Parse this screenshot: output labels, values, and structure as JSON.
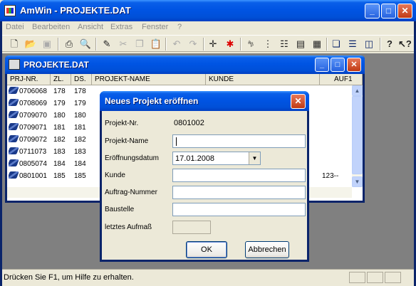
{
  "app": {
    "title": "AmWin - PROJEKTE.DAT",
    "minimize": "_",
    "maximize": "□",
    "close": "✕"
  },
  "menu": [
    "Datei",
    "Bearbeiten",
    "Ansicht",
    "Extras",
    "Fenster",
    "?"
  ],
  "toolbar": {
    "icons": [
      "new-file-icon",
      "open-folder-icon",
      "save-icon",
      "print-icon",
      "print-preview-icon",
      "edit-icon",
      "cut-icon",
      "copy-icon",
      "paste-icon",
      "undo-icon",
      "redo-icon",
      "move-icon",
      "cross-icon",
      "sort-icon",
      "tree-icon",
      "list-icon",
      "details-icon",
      "table-icon",
      "cascade-icon",
      "tile-horizontal-icon",
      "tile-vertical-icon",
      "help-icon",
      "context-help-icon"
    ]
  },
  "child": {
    "title": "PROJEKTE.DAT",
    "columns": [
      "PRJ-NR.",
      "ZL.",
      "DS.",
      "PROJEKT-NAME",
      "KUNDE",
      "AUF1"
    ],
    "rows": [
      {
        "nr": "0706068",
        "zl": "178",
        "ds": "178",
        "name": "",
        "kunde": "",
        "auf": ""
      },
      {
        "nr": "0708069",
        "zl": "179",
        "ds": "179",
        "name": "",
        "kunde": "",
        "auf": ""
      },
      {
        "nr": "0709070",
        "zl": "180",
        "ds": "180",
        "name": "",
        "kunde": "",
        "auf": ""
      },
      {
        "nr": "0709071",
        "zl": "181",
        "ds": "181",
        "name": "",
        "kunde": "",
        "auf": ""
      },
      {
        "nr": "0709072",
        "zl": "182",
        "ds": "182",
        "name": "",
        "kunde": "",
        "auf": ""
      },
      {
        "nr": "0711073",
        "zl": "183",
        "ds": "183",
        "name": "",
        "kunde": "",
        "auf": ""
      },
      {
        "nr": "0805074",
        "zl": "184",
        "ds": "184",
        "name": "",
        "kunde": "",
        "auf": ""
      },
      {
        "nr": "0801001",
        "zl": "185",
        "ds": "185",
        "name": "",
        "kunde": "",
        "auf": "123--"
      }
    ]
  },
  "dialog": {
    "title": "Neues Projekt eröffnen",
    "close": "✕",
    "projekt_nr_label": "Projekt-Nr.",
    "projekt_nr_value": "0801002",
    "projekt_name_label": "Projekt-Name",
    "projekt_name_value": "",
    "datum_label": "Eröffnungsdatum",
    "datum_value": "17.01.2008",
    "kunde_label": "Kunde",
    "kunde_value": "",
    "auftrag_label": "Auftrag-Nummer",
    "auftrag_value": "",
    "baustelle_label": "Baustelle",
    "baustelle_value": "",
    "aufmass_label": "letztes Aufmaß",
    "ok": "OK",
    "cancel": "Abbrechen"
  },
  "status": {
    "text": "Drücken Sie F1, um Hilfe zu erhalten."
  }
}
